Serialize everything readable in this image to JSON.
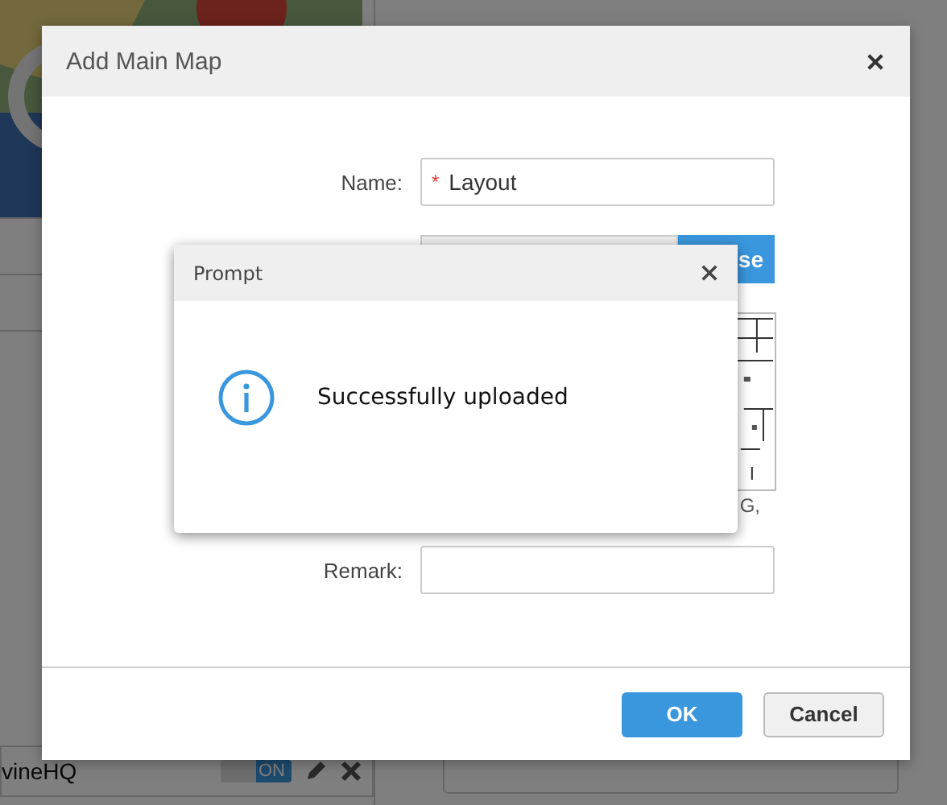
{
  "background": {
    "list_item": {
      "title": "vineHQ",
      "toggle": {
        "label": "ON",
        "on": true
      }
    }
  },
  "dialog": {
    "title": "Add Main Map",
    "fields": [
      {
        "kind": "text",
        "label": "Name:",
        "required_mark": "*",
        "value": "Layout"
      },
      {
        "kind": "file",
        "button": "se"
      },
      {
        "kind": "preview",
        "note": "G,"
      },
      {
        "kind": "text",
        "label": "Remark:"
      }
    ],
    "buttons": [
      {
        "label": "OK",
        "primary": true
      },
      {
        "label": "Cancel",
        "primary": false
      }
    ]
  },
  "prompt": {
    "title": "Prompt",
    "message": "Successfully uploaded"
  }
}
